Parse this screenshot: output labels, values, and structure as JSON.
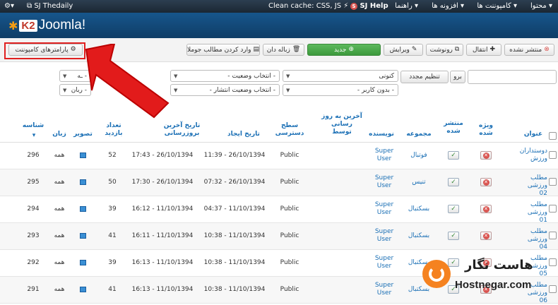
{
  "topbar": {
    "items_right": [
      "محتوا ▾",
      "کامپوننت ها ▾",
      "افزونه ها ▾",
      "راهنما ▾"
    ],
    "sj_help": "SJ Help",
    "clean_cache": "Clean cache: CSS, JS",
    "user": "SJ Thedaily"
  },
  "logo": {
    "k2": "K2",
    "joomla": "Joomla!"
  },
  "toolbar": {
    "unpublished": "منتشر نشده",
    "move": "انتقال",
    "copy": "رونوشت",
    "edit": "ویرایش",
    "new": "جدید",
    "trash": "زباله دان",
    "import": "وارد کردن مطالب جوملا",
    "params": "پارامترهای کامپوننت"
  },
  "filters": {
    "go": "برو",
    "reset": "تنظیم مجدد",
    "trash_sel": "کنونی",
    "category_sel": "- انتخاب وضعیت -",
    "author_sel": "- بدون کاربر -",
    "publish_state_sel": "- انتخاب وضعیت انتشار -",
    "level_sel": "- انتخاب وضعیت -",
    "cut_a": "ـه -",
    "cut_b": "ربان -"
  },
  "columns": {
    "title": "عنوان",
    "featured": "ویژه شده",
    "published": "منتشر شده",
    "category": "مجموعه",
    "author": "نویسنده",
    "last_editor": "آخرین به روز رسانی توسط",
    "access": "سطح دسترسی",
    "created": "تاریخ ایجاد",
    "modified": "تاریخ آخرین بروزرسانی",
    "hits": "تعداد بازدید",
    "image": "تصویر",
    "language": "زبان",
    "id": "شناسه"
  },
  "rows": [
    {
      "title": "دوستداران ورزش",
      "category": "فوتبال",
      "author": "Super User",
      "access": "Public",
      "created": "11:39 - 26/10/1394",
      "modified": "17:43 - 26/10/1394",
      "hits": "52",
      "language": "همه",
      "id": "296"
    },
    {
      "title": "مطلب ورزشی 02",
      "category": "تنیس",
      "author": "Super User",
      "access": "Public",
      "created": "07:32 - 26/10/1394",
      "modified": "17:30 - 26/10/1394",
      "hits": "50",
      "language": "همه",
      "id": "295"
    },
    {
      "title": "مطلب ورزشی 01",
      "category": "بسکتبال",
      "author": "Super User",
      "access": "Public",
      "created": "04:37 - 11/10/1394",
      "modified": "16:12 - 11/10/1394",
      "hits": "39",
      "language": "همه",
      "id": "294"
    },
    {
      "title": "مطلب ورزشی 04",
      "category": "بسکتبال",
      "author": "Super User",
      "access": "Public",
      "created": "10:38 - 11/10/1394",
      "modified": "16:11 - 11/10/1394",
      "hits": "41",
      "language": "همه",
      "id": "293"
    },
    {
      "title": "مطلب ورزشی 05",
      "category": "بسکتبال",
      "author": "Super User",
      "access": "Public",
      "created": "10:38 - 11/10/1394",
      "modified": "16:13 - 11/10/1394",
      "hits": "39",
      "language": "همه",
      "id": "292"
    },
    {
      "title": "مطلب ورزشی 06",
      "category": "بسکتبال",
      "author": "Super User",
      "access": "Public",
      "created": "10:38 - 11/10/1394",
      "modified": "16:13 - 11/10/1394",
      "hits": "41",
      "language": "همه",
      "id": "291"
    }
  ],
  "watermark": {
    "fa": "هاست نگار",
    "en": "Hostnegar.com"
  },
  "colors": {
    "accent": "#1a6fb5",
    "highlight": "#e02020",
    "green": "#4cae4c"
  }
}
